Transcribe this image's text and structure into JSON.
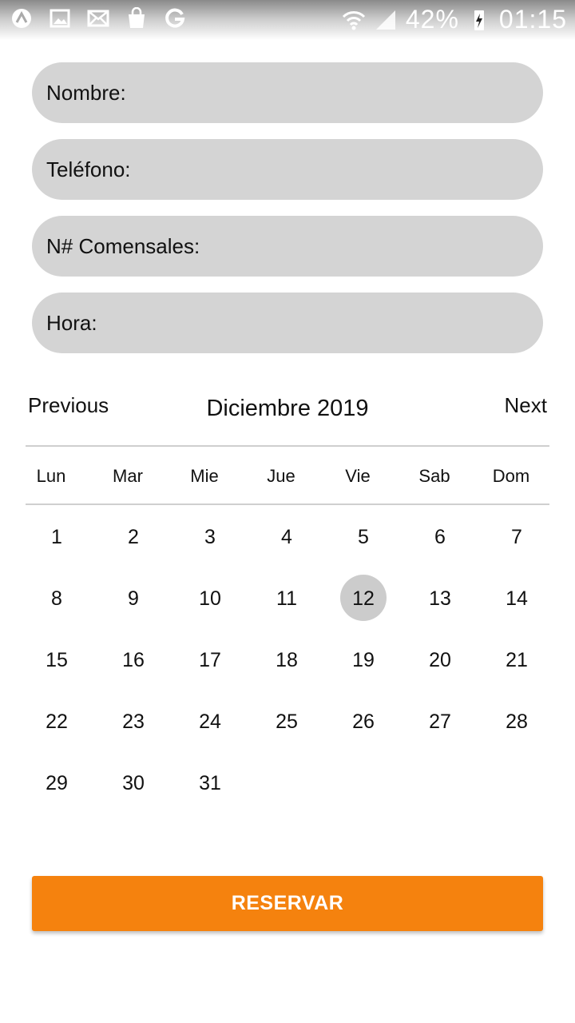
{
  "status_bar": {
    "battery": "42%",
    "time": "01:15",
    "icons": [
      "app-icon",
      "image-icon",
      "mail-icon",
      "shopping-bag-icon",
      "google-icon",
      "wifi-icon",
      "signal-icon",
      "charging-icon"
    ]
  },
  "form": {
    "nombre_label": "Nombre:",
    "telefono_label": "Teléfono:",
    "comensales_label": "N# Comensales:",
    "hora_label": "Hora:"
  },
  "calendar": {
    "previous_label": "Previous",
    "next_label": "Next",
    "month_title": "Diciembre 2019",
    "weekdays": [
      "Lun",
      "Mar",
      "Mie",
      "Jue",
      "Vie",
      "Sab",
      "Dom"
    ],
    "weeks": [
      [
        "1",
        "2",
        "3",
        "4",
        "5",
        "6",
        "7"
      ],
      [
        "8",
        "9",
        "10",
        "11",
        "12",
        "13",
        "14"
      ],
      [
        "15",
        "16",
        "17",
        "18",
        "19",
        "20",
        "21"
      ],
      [
        "22",
        "23",
        "24",
        "25",
        "26",
        "27",
        "28"
      ],
      [
        "29",
        "30",
        "31",
        "",
        "",
        "",
        ""
      ]
    ],
    "selected_day": "12"
  },
  "reserve_button_label": "RESERVAR",
  "colors": {
    "accent": "#f5820e",
    "field_background": "#d4d4d4",
    "selected_day": "#cccccc"
  }
}
